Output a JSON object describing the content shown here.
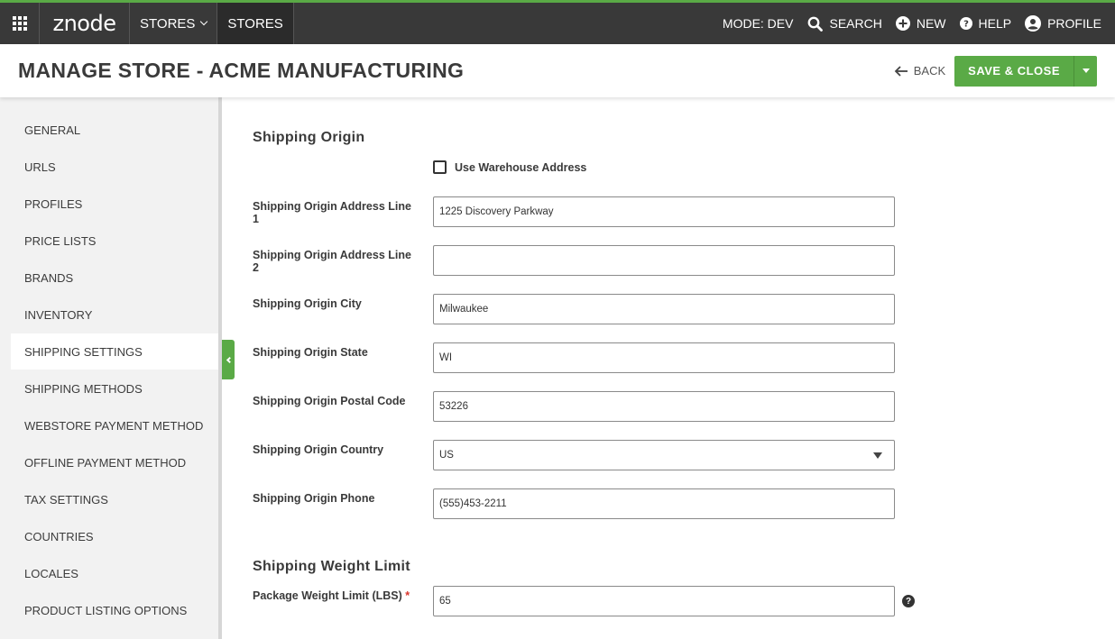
{
  "topbar": {
    "logo": "znode",
    "nav": [
      {
        "label": "STORES",
        "dropdown": true
      },
      {
        "label": "STORES",
        "active": true
      }
    ],
    "mode_label": "MODE: DEV",
    "search_label": "SEARCH",
    "new_label": "NEW",
    "help_label": "HELP",
    "profile_label": "PROFILE"
  },
  "header": {
    "title": "MANAGE STORE - ACME MANUFACTURING",
    "back_label": "BACK",
    "save_label": "SAVE & CLOSE"
  },
  "sidebar": {
    "items": [
      {
        "label": "GENERAL"
      },
      {
        "label": "URLS"
      },
      {
        "label": "PROFILES"
      },
      {
        "label": "PRICE LISTS"
      },
      {
        "label": "BRANDS"
      },
      {
        "label": "INVENTORY"
      },
      {
        "label": "SHIPPING SETTINGS",
        "active": true
      },
      {
        "label": "SHIPPING METHODS"
      },
      {
        "label": "WEBSTORE PAYMENT METHOD"
      },
      {
        "label": "OFFLINE PAYMENT METHOD"
      },
      {
        "label": "TAX SETTINGS"
      },
      {
        "label": "COUNTRIES"
      },
      {
        "label": "LOCALES"
      },
      {
        "label": "PRODUCT LISTING OPTIONS"
      }
    ]
  },
  "main": {
    "shipping_origin": {
      "title": "Shipping Origin",
      "use_warehouse_label": "Use Warehouse Address",
      "use_warehouse_checked": false,
      "address1": {
        "label": "Shipping Origin Address Line 1",
        "value": "1225 Discovery Parkway"
      },
      "address2": {
        "label": "Shipping Origin Address Line 2",
        "value": ""
      },
      "city": {
        "label": "Shipping Origin City",
        "value": "Milwaukee"
      },
      "state": {
        "label": "Shipping Origin State",
        "value": "WI"
      },
      "postal": {
        "label": "Shipping Origin Postal Code",
        "value": "53226"
      },
      "country": {
        "label": "Shipping Origin Country",
        "value": "US"
      },
      "phone": {
        "label": "Shipping Origin Phone",
        "value": "(555)453-2211"
      }
    },
    "weight_limit": {
      "title": "Shipping Weight Limit",
      "package_limit": {
        "label": "Package Weight Limit (LBS)",
        "required_mark": "*",
        "value": "65"
      }
    }
  },
  "colors": {
    "brand_green": "#5aaa46",
    "topbar_bg": "#393939",
    "sidebar_bg": "#f2f2f2",
    "required": "#d9342b"
  },
  "icons": [
    "grid-icon",
    "chevron-down-icon",
    "search-icon",
    "plus-circle-icon",
    "help-circle-icon",
    "user-circle-icon",
    "arrow-left-icon",
    "caret-down-icon",
    "chevron-left-icon",
    "question-icon"
  ]
}
